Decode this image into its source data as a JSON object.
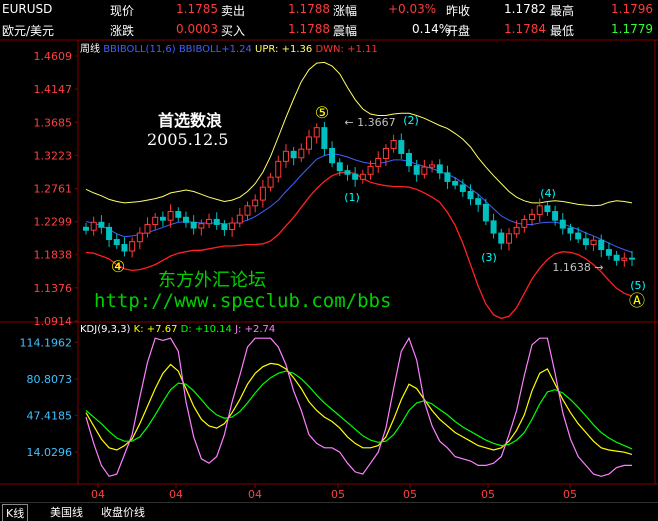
{
  "header": {
    "row1": {
      "symbol": "EURUSD",
      "label1": "现价",
      "val1": "1.1785",
      "label2": "卖出",
      "val2": "1.1788",
      "label3": "涨幅",
      "val3": "+0.03%",
      "label4": "昨收",
      "val4": "1.1782",
      "label5": "最高",
      "val5": "1.1796"
    },
    "row2": {
      "name": "欧元/美元",
      "label1": "涨跌",
      "val1": "0.0003",
      "label2": "买入",
      "val2": "1.1788",
      "label3": "震幅",
      "val3": "0.14%",
      "label4": "开盘",
      "val4": "1.1784",
      "label5": "最低",
      "val5": "1.1779"
    }
  },
  "colors": {
    "up": "#ff3a3a",
    "down": "#00c0c0",
    "mid": "#4060ff",
    "upper": "#ffff66",
    "lower": "#ff2020",
    "kdj_k": "#ffff00",
    "kdj_d": "#00ff00",
    "kdj_j": "#ff80ff"
  },
  "chart_data": [
    {
      "type": "candlestick",
      "title": "周线",
      "indicator": "BBIBOLL(11,6)",
      "legend": [
        {
          "name": "BBIBOLL",
          "value": "+1.24"
        },
        {
          "name": "UPR",
          "value": "+1.36"
        },
        {
          "name": "DWN",
          "value": "+1.11"
        }
      ],
      "ylim": [
        1.09,
        1.4609
      ],
      "y_ticks": [
        "1.4609",
        "1.4147",
        "1.3685",
        "1.3223",
        "1.2761",
        "1.2299",
        "1.1838",
        "1.1376",
        "1.0914"
      ],
      "annotations": {
        "title_text": "首选数浪",
        "date_text": "2005.12.5",
        "peak_label": "1.3667",
        "low_label": "1.1638",
        "wave_labels": [
          "⑤",
          "(1)",
          "(2)",
          "(3)",
          "(4)",
          "(5)",
          "④",
          "Ⓐ"
        ],
        "watermark1": "东方外汇论坛",
        "watermark2": "http://www.speclub.com/bbs"
      },
      "closes": [
        1.218,
        1.229,
        1.222,
        1.205,
        1.198,
        1.189,
        1.202,
        1.214,
        1.226,
        1.236,
        1.232,
        1.244,
        1.236,
        1.229,
        1.221,
        1.227,
        1.233,
        1.226,
        1.219,
        1.228,
        1.239,
        1.252,
        1.26,
        1.278,
        1.292,
        1.314,
        1.328,
        1.319,
        1.331,
        1.348,
        1.361,
        1.332,
        1.312,
        1.301,
        1.296,
        1.289,
        1.296,
        1.307,
        1.318,
        1.332,
        1.343,
        1.325,
        1.308,
        1.296,
        1.306,
        1.309,
        1.298,
        1.286,
        1.281,
        1.272,
        1.262,
        1.254,
        1.231,
        1.214,
        1.2,
        1.213,
        1.222,
        1.233,
        1.24,
        1.252,
        1.244,
        1.232,
        1.221,
        1.214,
        1.206,
        1.198,
        1.204,
        1.191,
        1.183,
        1.176,
        1.179,
        1.1785
      ],
      "bboll_mid": [
        1.23,
        1.228,
        1.224,
        1.219,
        1.213,
        1.209,
        1.21,
        1.212,
        1.215,
        1.218,
        1.222,
        1.226,
        1.229,
        1.23,
        1.229,
        1.228,
        1.228,
        1.228,
        1.227,
        1.227,
        1.229,
        1.232,
        1.237,
        1.244,
        1.251,
        1.26,
        1.272,
        1.283,
        1.295,
        1.306,
        1.317,
        1.322,
        1.325,
        1.323,
        1.32,
        1.316,
        1.313,
        1.311,
        1.311,
        1.313,
        1.316,
        1.316,
        1.314,
        1.31,
        1.307,
        1.304,
        1.3,
        1.296,
        1.291,
        1.284,
        1.276,
        1.268,
        1.258,
        1.248,
        1.238,
        1.232,
        1.228,
        1.226,
        1.226,
        1.228,
        1.229,
        1.229,
        1.227,
        1.223,
        1.219,
        1.214,
        1.21,
        1.205,
        1.2,
        1.195,
        1.191,
        1.187
      ],
      "bboll_upper": [
        1.275,
        1.27,
        1.266,
        1.261,
        1.258,
        1.256,
        1.257,
        1.258,
        1.26,
        1.262,
        1.265,
        1.27,
        1.272,
        1.274,
        1.272,
        1.268,
        1.264,
        1.261,
        1.258,
        1.26,
        1.264,
        1.272,
        1.283,
        1.299,
        1.321,
        1.348,
        1.375,
        1.401,
        1.425,
        1.442,
        1.451,
        1.452,
        1.447,
        1.436,
        1.417,
        1.4,
        1.387,
        1.38,
        1.378,
        1.378,
        1.38,
        1.381,
        1.381,
        1.378,
        1.374,
        1.369,
        1.364,
        1.36,
        1.353,
        1.345,
        1.334,
        1.319,
        1.306,
        1.294,
        1.283,
        1.272,
        1.264,
        1.259,
        1.256,
        1.256,
        1.258,
        1.259,
        1.258,
        1.256,
        1.254,
        1.253,
        1.252,
        1.253,
        1.257,
        1.259,
        1.258,
        1.256
      ],
      "bboll_lower": [
        1.187,
        1.186,
        1.182,
        1.178,
        1.17,
        1.164,
        1.162,
        1.163,
        1.166,
        1.17,
        1.176,
        1.182,
        1.186,
        1.188,
        1.19,
        1.19,
        1.192,
        1.194,
        1.196,
        1.196,
        1.197,
        1.198,
        1.198,
        1.199,
        1.203,
        1.212,
        1.224,
        1.236,
        1.25,
        1.264,
        1.276,
        1.286,
        1.294,
        1.298,
        1.299,
        1.297,
        1.29,
        1.285,
        1.282,
        1.28,
        1.279,
        1.279,
        1.278,
        1.275,
        1.27,
        1.264,
        1.257,
        1.243,
        1.225,
        1.2,
        1.17,
        1.14,
        1.115,
        1.1,
        1.095,
        1.098,
        1.11,
        1.13,
        1.15,
        1.165,
        1.177,
        1.185,
        1.188,
        1.187,
        1.184,
        1.178,
        1.17,
        1.16,
        1.148,
        1.137,
        1.13,
        1.126
      ]
    },
    {
      "type": "line",
      "title": "KDJ(9,3,3)",
      "legend": [
        {
          "name": "K",
          "value": "+7.67"
        },
        {
          "name": "D",
          "value": "+10.14"
        },
        {
          "name": "J",
          "value": "+2.74"
        }
      ],
      "ylim": [
        -15,
        120
      ],
      "y_ticks": [
        "114.1962",
        "80.8073",
        "47.4185",
        "14.0296"
      ],
      "x_tick_labels": [
        "04",
        "04",
        "04",
        "05",
        "05",
        "05",
        "05"
      ],
      "series": [
        {
          "name": "K",
          "values": [
            50,
            38,
            26,
            18,
            16,
            20,
            26,
            40,
            56,
            72,
            86,
            94,
            88,
            72,
            56,
            44,
            38,
            36,
            40,
            50,
            62,
            76,
            86,
            92,
            95,
            94,
            90,
            82,
            72,
            60,
            52,
            46,
            42,
            36,
            28,
            22,
            18,
            18,
            20,
            28,
            44,
            62,
            76,
            72,
            62,
            52,
            44,
            38,
            32,
            28,
            24,
            20,
            18,
            16,
            18,
            24,
            34,
            48,
            70,
            86,
            90,
            76,
            62,
            50,
            40,
            32,
            24,
            18,
            16,
            15,
            14,
            12
          ]
        },
        {
          "name": "D",
          "values": [
            52,
            46,
            40,
            33,
            27,
            24,
            24,
            28,
            37,
            48,
            60,
            71,
            77,
            76,
            70,
            62,
            54,
            48,
            45,
            46,
            51,
            59,
            68,
            76,
            82,
            86,
            88,
            86,
            81,
            74,
            66,
            59,
            53,
            47,
            41,
            35,
            29,
            25,
            23,
            24,
            30,
            40,
            52,
            59,
            61,
            58,
            53,
            48,
            42,
            37,
            33,
            29,
            25,
            22,
            20,
            21,
            25,
            32,
            44,
            58,
            69,
            71,
            68,
            62,
            55,
            47,
            39,
            32,
            27,
            23,
            20,
            17
          ]
        },
        {
          "name": "J",
          "values": [
            46,
            22,
            2,
            -8,
            -6,
            12,
            30,
            64,
            96,
            118,
            116,
            118,
            106,
            60,
            28,
            8,
            4,
            10,
            30,
            60,
            84,
            110,
            118,
            118,
            118,
            110,
            94,
            70,
            52,
            30,
            22,
            18,
            18,
            14,
            4,
            -4,
            -6,
            4,
            14,
            36,
            72,
            106,
            118,
            98,
            60,
            38,
            24,
            18,
            10,
            8,
            6,
            2,
            2,
            4,
            10,
            30,
            52,
            84,
            112,
            118,
            118,
            86,
            50,
            26,
            10,
            2,
            -6,
            -8,
            -6,
            0,
            2,
            2
          ]
        }
      ]
    }
  ],
  "x_ticks_label_positions": "bottom",
  "tabs": [
    {
      "label": "K线"
    },
    {
      "label": "美国线"
    },
    {
      "label": "收盘价线"
    }
  ]
}
